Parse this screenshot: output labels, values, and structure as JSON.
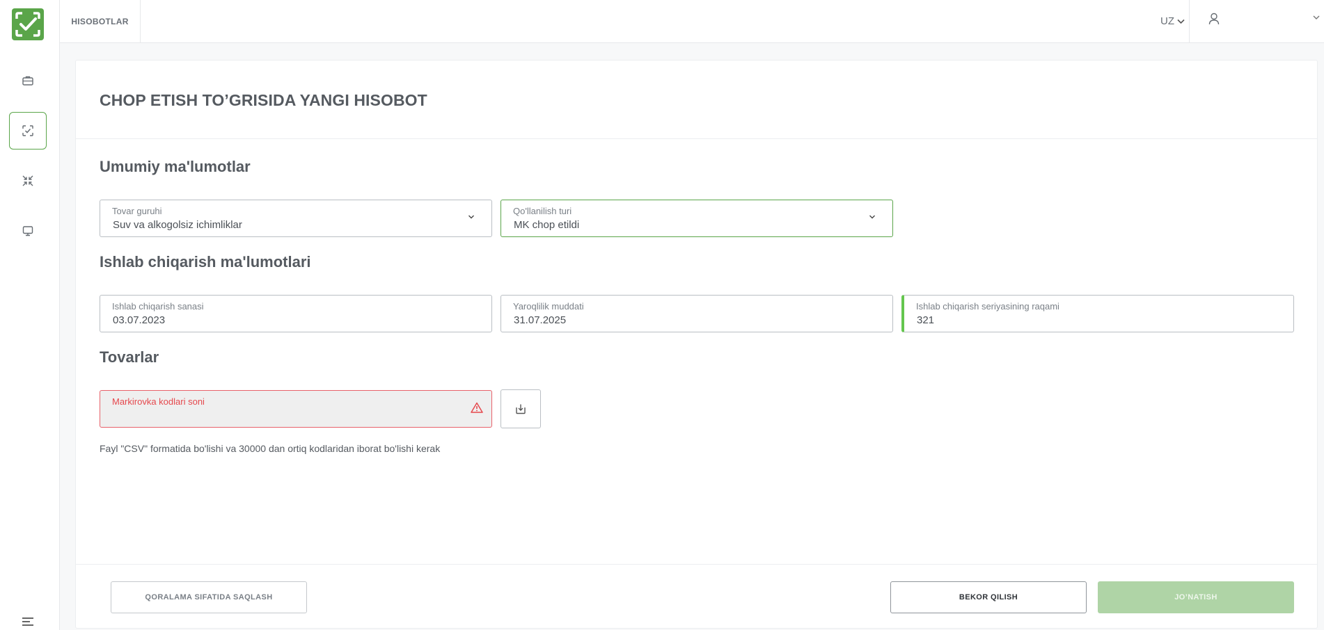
{
  "app": {
    "brand_color": "#5aa549",
    "error_color": "#e5484d"
  },
  "header": {
    "tab_label": "HISOBOTLAR",
    "language": "UZ"
  },
  "sidebar": {
    "items": [
      {
        "icon": "briefcase-icon",
        "active": false
      },
      {
        "icon": "scan-check-icon",
        "active": true
      },
      {
        "icon": "compress-arrows-icon",
        "active": false
      },
      {
        "icon": "monitor-icon",
        "active": false
      }
    ]
  },
  "page": {
    "title": "CHOP ETISH TO’GRISIDA YANGI HISOBOT"
  },
  "general": {
    "section_title": "Umumiy ma'lumotlar",
    "product_group": {
      "label": "Tovar guruhi",
      "value": "Suv va alkogolsiz ichimliklar"
    },
    "usage_type": {
      "label": "Qo'llanilish turi",
      "value": "MK chop etildi"
    }
  },
  "production": {
    "section_title": "Ishlab chiqarish ma'lumotlari",
    "production_date": {
      "label": "Ishlab chiqarish sanasi",
      "value": "03.07.2023"
    },
    "expiry_date": {
      "label": "Yaroqlilik muddati",
      "value": "31.07.2025"
    },
    "batch_number": {
      "label": "Ishlab chiqarish seriyasining raqami",
      "value": "321"
    }
  },
  "goods": {
    "section_title": "Tovarlar",
    "marking_codes": {
      "label": "Markirovka kodlari soni",
      "value": ""
    },
    "hint": "Fayl \"CSV\" formatida bo'lishi va 30000 dan ortiq kodlaridan iborat bo'lishi kerak"
  },
  "footer": {
    "draft_label": "QORALAMA SIFATIDA SAQLASH",
    "cancel_label": "BEKOR QILISH",
    "send_label": "JO’NATISH"
  }
}
